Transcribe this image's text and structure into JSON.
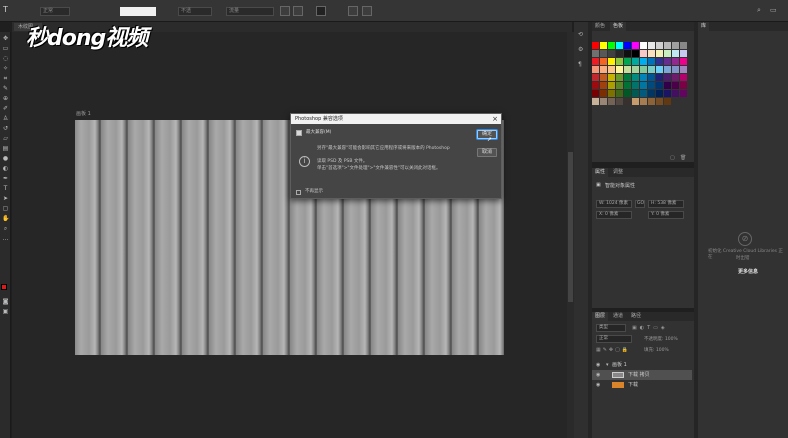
{
  "watermark": "秒dong视频",
  "options_bar": {
    "field_1": "正常",
    "field_2": "不透",
    "field_3": "流量"
  },
  "document": {
    "tab_label": "木纹图...",
    "artboard_label": "画板 1"
  },
  "dialog": {
    "title": "Photoshop 兼容选项",
    "checkbox_label": "最大兼容(M)",
    "info_line1": "另存\"最大兼容\"可能会影响其它应用程序或将来版本的 Photoshop",
    "info_line2": "读取 PSD 及 PSB 文件。",
    "info_line3": "单击\"首选项\">\"文件处理\">\"文件兼容性\"可以关闭此对话框。",
    "dont_show": "不再显示",
    "ok_label": "确定",
    "cancel_label": "取消"
  },
  "swatches_panel": {
    "tabs": [
      "颜色",
      "色板"
    ],
    "active_tab": 1
  },
  "properties_panel": {
    "tabs": [
      "属性",
      "调整"
    ],
    "active_tab": 0,
    "section_title": "智能对象属性",
    "w_label": "W: 1024 像素",
    "h_label": "H: 538 像素",
    "x_label": "X: 0 像素",
    "y_label": "Y: 0 像素",
    "link_label": "GO"
  },
  "layers_panel": {
    "tabs": [
      "图层",
      "通道",
      "路径"
    ],
    "active_tab": 0,
    "filter_placeholder": "类型",
    "blend_mode": "正常",
    "opacity_label": "不透明度: 100%",
    "fill_label": "填充: 100%",
    "layers": [
      {
        "name": "画板 1",
        "type": "group"
      },
      {
        "name": "下载 拷贝",
        "type": "smart-object",
        "selected": true
      },
      {
        "name": "下载",
        "type": "image"
      }
    ]
  },
  "library_panel": {
    "tab_label": "库",
    "message_line1": "初始化 Creative Cloud Libraries 正在",
    "message_line2": "时出错",
    "link_text": "更多信息"
  },
  "colors": {
    "accent": "#2d8ceb",
    "foreground": "#e01818",
    "background": "#ffffff"
  }
}
